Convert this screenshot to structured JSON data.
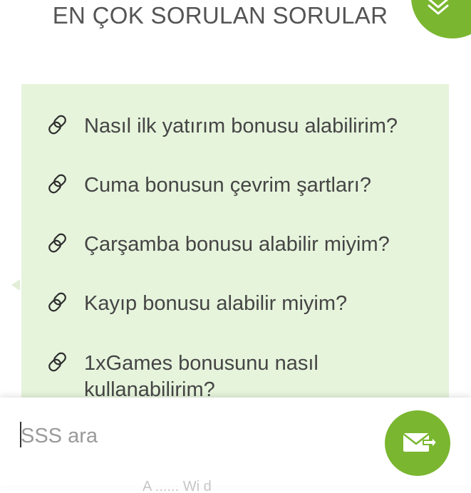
{
  "header": {
    "title": "EN ÇOK SORULAN SORULAR"
  },
  "faq": {
    "items": [
      {
        "label": "Nasıl ilk yatırım bonusu alabilirim?",
        "icon": "link-icon"
      },
      {
        "label": "Cuma bonusun çevrim şartları?",
        "icon": "link-icon"
      },
      {
        "label": "Çarşamba bonusu alabilir miyim?",
        "icon": "link-icon"
      },
      {
        "label": "Kayıp bonusu alabilir miyim?",
        "icon": "link-icon"
      },
      {
        "label": "1xGames bonusunu nasıl kullanabilirim?",
        "icon": "link-icon"
      }
    ]
  },
  "search": {
    "value": "",
    "placeholder": "SSS ara",
    "send_icon": "envelope-send-icon"
  },
  "footer": {
    "partial_text": "A ...... Wi d"
  },
  "colors": {
    "accent": "#7ab62f",
    "panel_background": "#e6f4dc",
    "title_text": "#545454",
    "item_text": "#454545"
  }
}
